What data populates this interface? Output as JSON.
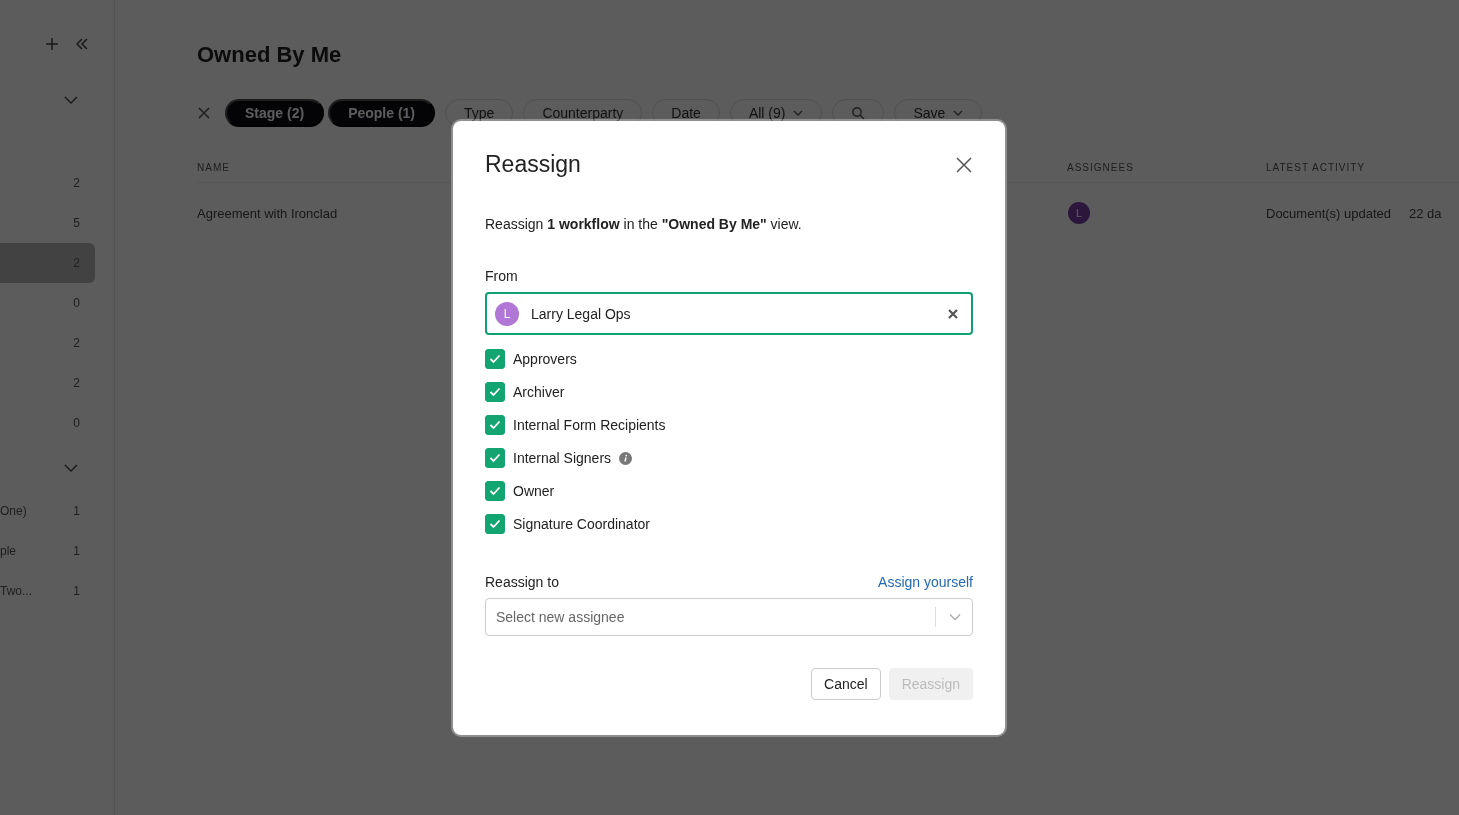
{
  "sidebar": {
    "groups": [
      {
        "expanded": true,
        "items": [
          {
            "count": "2",
            "selected": false
          },
          {
            "count": "5",
            "selected": false
          },
          {
            "count": "2",
            "selected": true
          },
          {
            "count": "0",
            "selected": false
          },
          {
            "count": "2",
            "selected": false
          },
          {
            "count": "2",
            "selected": false
          },
          {
            "count": "0",
            "selected": false
          }
        ]
      },
      {
        "expanded": true,
        "items": [
          {
            "label": "One)",
            "count": "1",
            "selected": false
          },
          {
            "label": "ple",
            "count": "1",
            "selected": false
          },
          {
            "label": "Two...",
            "count": "1",
            "selected": false
          }
        ]
      }
    ]
  },
  "main": {
    "title": "Owned By Me",
    "filters": [
      {
        "kind": "active",
        "label": "Stage (2)"
      },
      {
        "kind": "active",
        "label": "People (1)"
      },
      {
        "kind": "outline",
        "label": "Type"
      },
      {
        "kind": "outline",
        "label": "Counterparty"
      },
      {
        "kind": "outline",
        "label": "Date"
      },
      {
        "kind": "dropdown",
        "label": "All (9)"
      },
      {
        "kind": "search"
      },
      {
        "kind": "dropdown",
        "label": "Save"
      }
    ],
    "table": {
      "columns": [
        "NAME",
        "ASSIGNEES",
        "LATEST ACTIVITY"
      ],
      "rows": [
        {
          "name": "Agreement with Ironclad",
          "assignee_initial": "L",
          "activity": "Document(s) updated",
          "time": "22 da"
        }
      ]
    }
  },
  "dialog": {
    "title": "Reassign",
    "message": "Reassign **1 workflow** in the **\"Owned By Me\"** view.",
    "from": {
      "label": "From",
      "focused": true,
      "avatar_initial": "L",
      "value": "Larry Legal Ops"
    },
    "roles": [
      {
        "label": "Approvers",
        "checked": true
      },
      {
        "label": "Archiver",
        "checked": true
      },
      {
        "label": "Internal Form Recipients",
        "checked": true
      },
      {
        "label": "Internal Signers",
        "checked": true,
        "info": true
      },
      {
        "label": "Owner",
        "checked": true
      },
      {
        "label": "Signature Coordinator",
        "checked": true
      }
    ],
    "reassign_to": {
      "label": "Reassign to",
      "link": "Assign yourself",
      "placeholder": "Select new assignee"
    },
    "buttons": [
      {
        "kind": "secondary",
        "label": "Cancel",
        "disabled": false
      },
      {
        "kind": "primary",
        "label": "Reassign",
        "disabled": true
      }
    ]
  }
}
